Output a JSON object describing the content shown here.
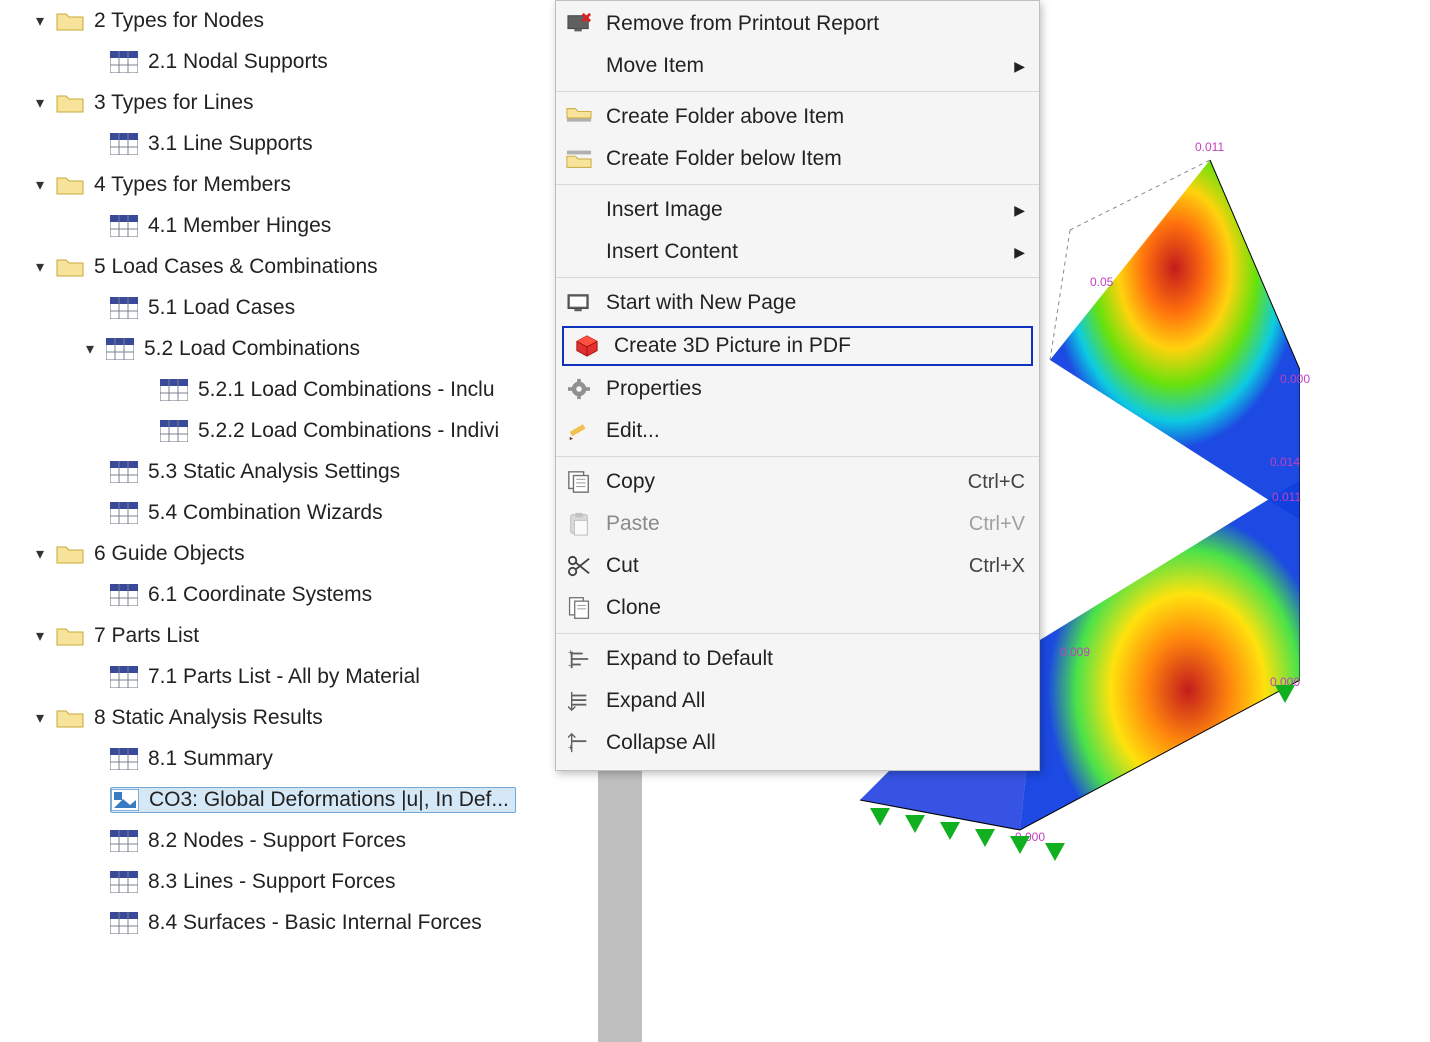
{
  "tree": {
    "n0": "2 Types for Nodes",
    "n0a": "2.1 Nodal Supports",
    "n1": "3 Types for Lines",
    "n1a": "3.1 Line Supports",
    "n2": "4 Types for Members",
    "n2a": "4.1 Member Hinges",
    "n3": "5 Load Cases & Combinations",
    "n3a": "5.1 Load Cases",
    "n3b": "5.2 Load Combinations",
    "n3b1": "5.2.1 Load Combinations - Inclu",
    "n3b2": "5.2.2 Load Combinations - Indivi",
    "n3c": "5.3 Static Analysis Settings",
    "n3d": "5.4 Combination Wizards",
    "n4": "6 Guide Objects",
    "n4a": "6.1 Coordinate Systems",
    "n5": "7 Parts List",
    "n5a": "7.1 Parts List - All by Material",
    "n6": "8 Static Analysis Results",
    "n6a": "8.1 Summary",
    "n6sel": "CO3: Global Deformations |u|, In Def...",
    "n6b": "8.2 Nodes - Support Forces",
    "n6c": "8.3 Lines - Support Forces",
    "n6d": "8.4 Surfaces - Basic Internal Forces"
  },
  "menu": {
    "remove": "Remove from Printout Report",
    "move": "Move Item",
    "folder_above": "Create Folder above Item",
    "folder_below": "Create Folder below Item",
    "insert_image": "Insert Image",
    "insert_content": "Insert Content",
    "start_new_page": "Start with New Page",
    "create_3d": "Create 3D Picture in PDF",
    "properties": "Properties",
    "edit": "Edit...",
    "copy": "Copy",
    "copy_sc": "Ctrl+C",
    "paste": "Paste",
    "paste_sc": "Ctrl+V",
    "cut": "Cut",
    "cut_sc": "Ctrl+X",
    "clone": "Clone",
    "expand_default": "Expand to Default",
    "expand_all": "Expand All",
    "collapse_all": "Collapse All"
  },
  "viz_labels": {
    "a": "0.011",
    "b": "0.05",
    "c": "0.000",
    "d": "0.014",
    "e": "0.011",
    "f": "0.009",
    "g": "0.000",
    "h": "0.000"
  }
}
